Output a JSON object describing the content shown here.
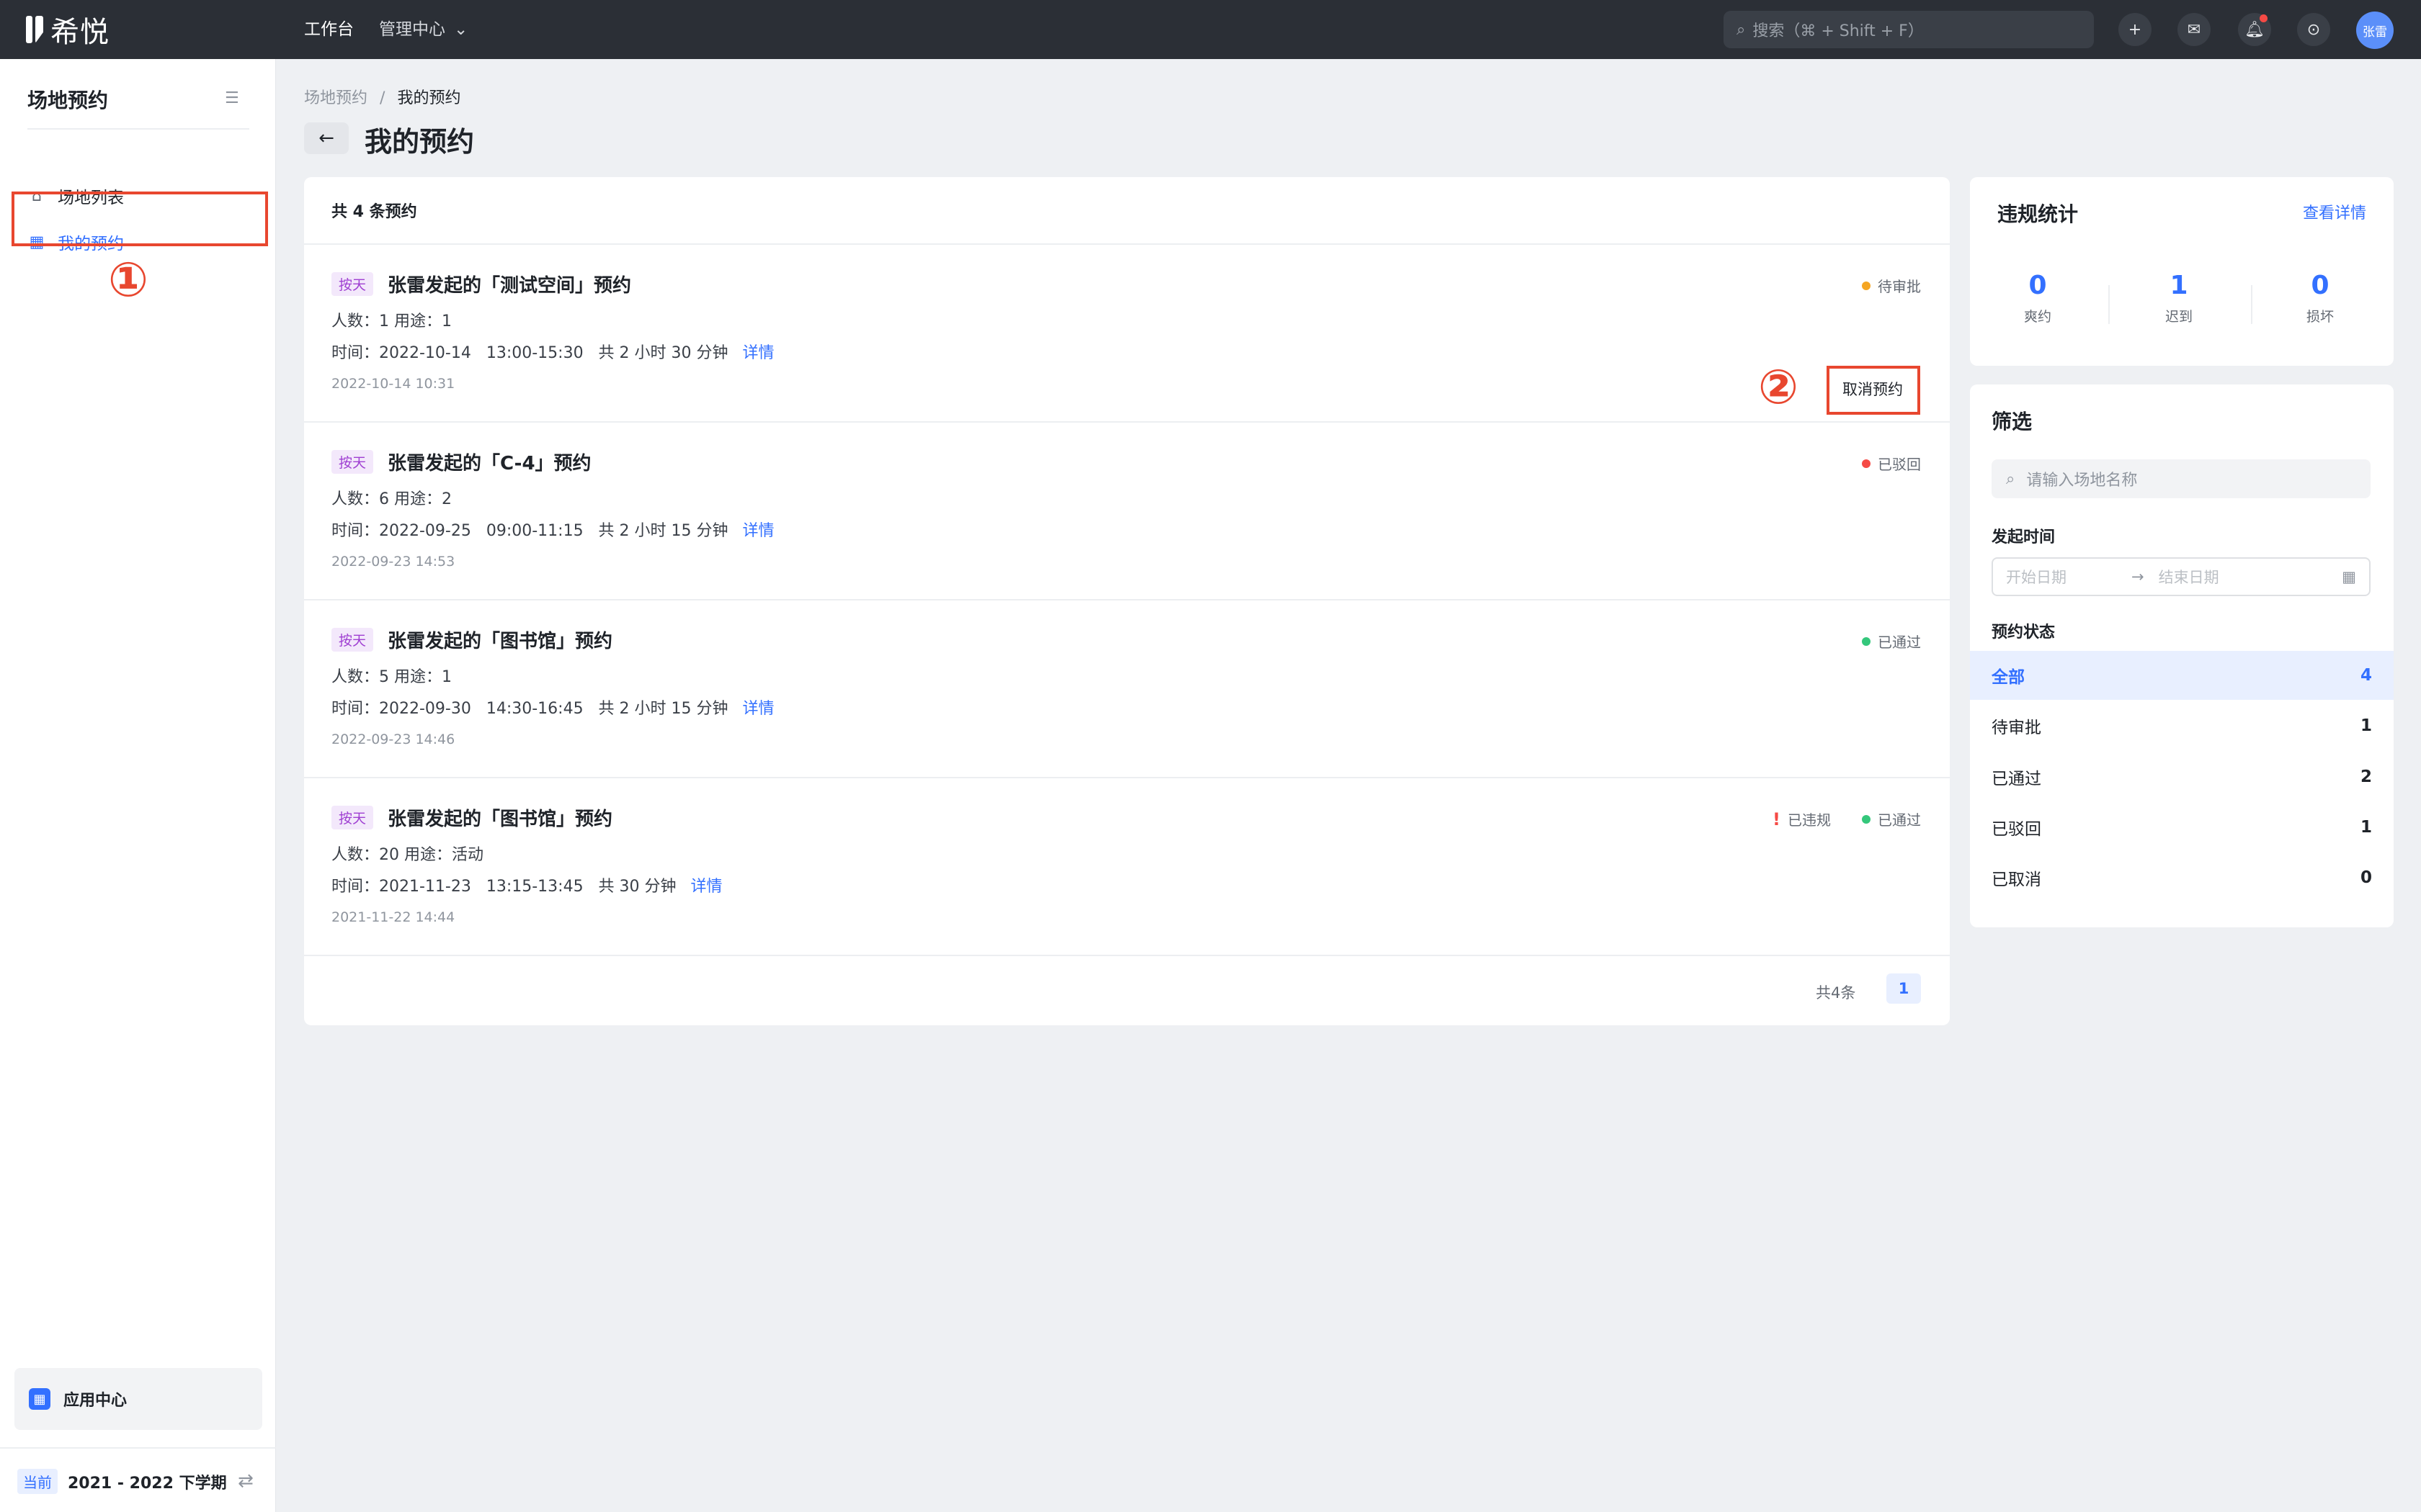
{
  "topbar": {
    "logo_text": "希悦",
    "nav_workbench": "工作台",
    "nav_admin": "管理中心",
    "search_placeholder": "搜索（⌘ + Shift + F）",
    "avatar_text": "张雷"
  },
  "sidebar": {
    "title": "场地预约",
    "items": [
      {
        "label": "场地列表",
        "icon": "venue-icon"
      },
      {
        "label": "我的预约",
        "icon": "calendar-icon",
        "active": true
      }
    ],
    "app_center": "应用中心",
    "term_current": "当前",
    "term_label": "2021 - 2022 下学期"
  },
  "annotations": {
    "one": "①",
    "two": "②"
  },
  "main": {
    "breadcrumb_root": "场地预约",
    "breadcrumb_sep": "/",
    "breadcrumb_current": "我的预约",
    "title": "我的预约",
    "total_label": "共 4 条预约",
    "cancel_button": "取消预约",
    "pager_total": "共4条",
    "pager_page": "1",
    "reservations": [
      {
        "tag": "按天",
        "title": "张雷发起的「测试空间」预约",
        "meta": "人数：1   用途：1",
        "time": "时间：2022-10-14   13:00-15:30   共 2 小时 30 分钟",
        "detail": "详情",
        "created": "2022-10-14 10:31",
        "status": "待审批",
        "status_color": "#f5a623"
      },
      {
        "tag": "按天",
        "title": "张雷发起的「C-4」预约",
        "meta": "人数：6   用途：2",
        "time": "时间：2022-09-25   09:00-11:15   共 2 小时 15 分钟",
        "detail": "详情",
        "created": "2022-09-23 14:53",
        "status": "已驳回",
        "status_color": "#f54a45"
      },
      {
        "tag": "按天",
        "title": "张雷发起的「图书馆」预约",
        "meta": "人数：5   用途：1",
        "time": "时间：2022-09-30   14:30-16:45   共 2 小时 15 分钟",
        "detail": "详情",
        "created": "2022-09-23 14:46",
        "status": "已通过",
        "status_color": "#34c77b"
      },
      {
        "tag": "按天",
        "title": "张雷发起的「图书馆」预约",
        "meta": "人数：20   用途：活动",
        "time": "时间：2021-11-23   13:15-13:45   共 30 分钟",
        "detail": "详情",
        "created": "2021-11-22 14:44",
        "status": "已通过",
        "status_color": "#34c77b",
        "violation": "已违规"
      }
    ]
  },
  "violations": {
    "title": "违规统计",
    "link": "查看详情",
    "stats": [
      {
        "value": "0",
        "label": "爽约"
      },
      {
        "value": "1",
        "label": "迟到"
      },
      {
        "value": "0",
        "label": "损坏"
      }
    ]
  },
  "filter": {
    "title": "筛选",
    "search_placeholder": "请输入场地名称",
    "time_label": "发起时间",
    "start_placeholder": "开始日期",
    "end_placeholder": "结束日期",
    "status_label": "预约状态",
    "options": [
      {
        "label": "全部",
        "count": "4",
        "active": true
      },
      {
        "label": "待审批",
        "count": "1"
      },
      {
        "label": "已通过",
        "count": "2"
      },
      {
        "label": "已驳回",
        "count": "1"
      },
      {
        "label": "已取消",
        "count": "0"
      }
    ]
  }
}
